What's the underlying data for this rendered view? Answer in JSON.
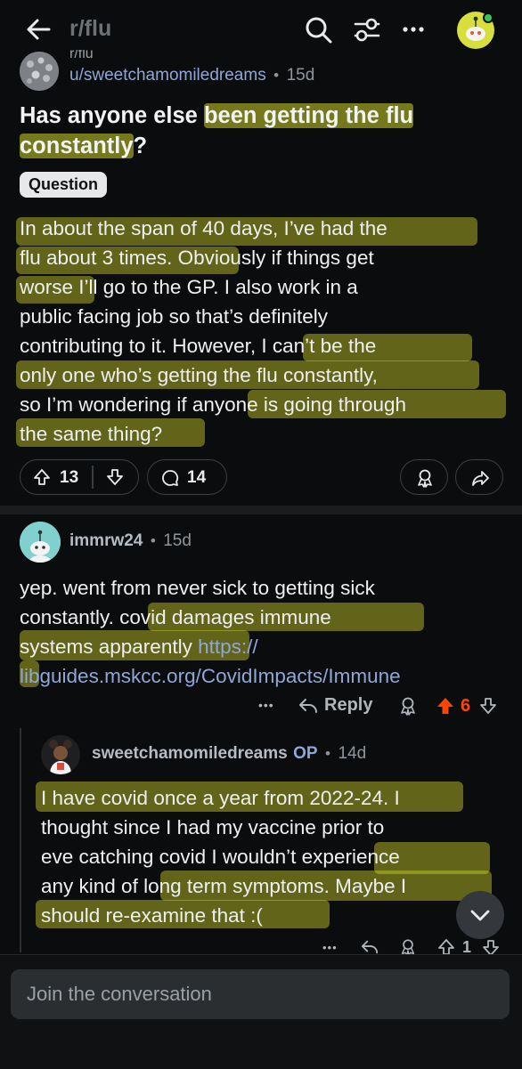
{
  "header": {
    "title": "r/flu",
    "subreddit_clip": "r/flu"
  },
  "post": {
    "author": "u/sweetchamomiledreams",
    "age": "15d",
    "separator": "•",
    "title_plain_1": "Has anyone else ",
    "title_hl_1": "been getting the flu",
    "title_hl_2": "constantly",
    "title_end": "?",
    "flair": "Question",
    "body_lines": [
      "In about the span of 40 days, I’ve had the",
      "flu about 3 times. Obviously if things get",
      "worse I’ll go to the GP. I also work in a",
      "public facing job so that’s definitely",
      "contributing to it. However, I can’t be the",
      "only one who’s getting the flu constantly,",
      "so I’m wondering if anyone is going through",
      "the same thing?"
    ],
    "upvotes": "13",
    "comments": "14"
  },
  "comments": [
    {
      "user": "immrw24",
      "age": "15d",
      "lines": [
        "yep. went from never sick to getting sick",
        "constantly. covid damages immune",
        "systems apparently "
      ],
      "link_part1": "https://",
      "link_part2": "libguides.mskcc.org/CovidImpacts/Immune",
      "more": "•••",
      "reply": "Reply",
      "votes": "6"
    },
    {
      "user": "sweetchamomiledreams",
      "op": "OP",
      "age": "14d",
      "lines": [
        "I have covid once a year from 2022-24. I",
        "thought since I had my vaccine prior to",
        "eve catching covid I wouldn’t experience",
        "any kind of long term symptoms. Maybe I",
        "should re-examine that :("
      ],
      "more": "•••",
      "votes": "1"
    }
  ],
  "composer": {
    "placeholder": "Join the conversation"
  },
  "colors": {
    "background": "#0b0c0d",
    "highlight": "#cdd228",
    "upvote_active": "#ff4500",
    "link": "#8fa7d6"
  }
}
